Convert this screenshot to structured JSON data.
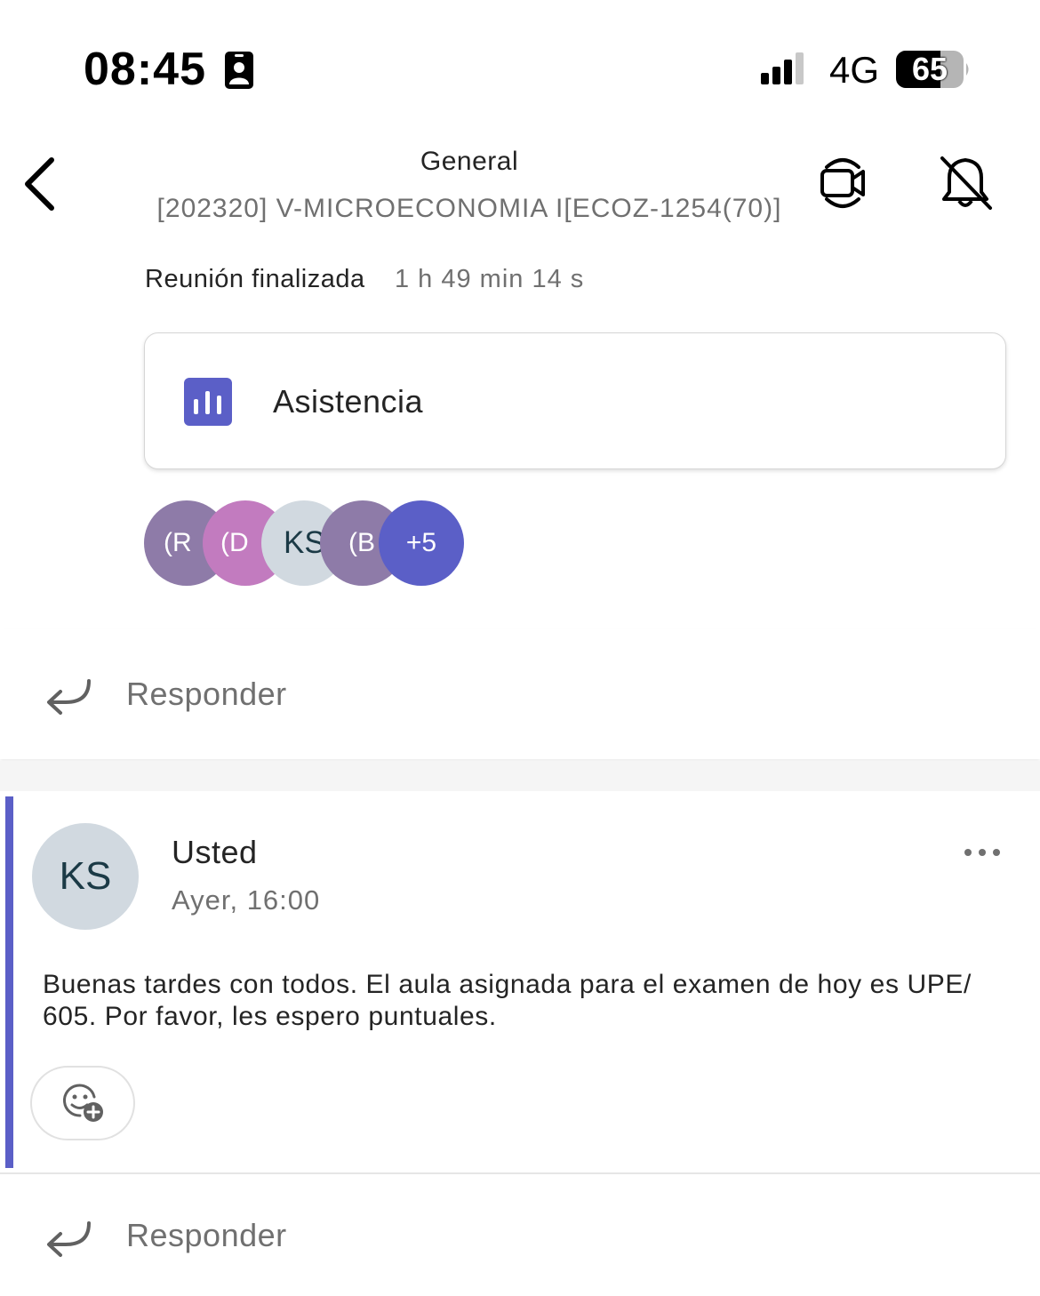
{
  "status_bar": {
    "time": "08:45",
    "network": "4G",
    "battery": "65",
    "icons": [
      "id-badge-icon",
      "signal-icon",
      "battery-icon"
    ]
  },
  "header": {
    "channel": "General",
    "team": "[202320] V-MICROECONOMIA I[ECOZ-1254(70)]",
    "icons": [
      "back-icon",
      "video-call-icon",
      "bell-off-icon"
    ]
  },
  "meeting": {
    "status": "Reunión finalizada",
    "duration": "1 h 49 min 14 s",
    "attendance_label": "Asistencia",
    "attendance_icon": "chart-icon",
    "participants": [
      {
        "initials": "(R",
        "color": "#8e7ba8",
        "text_color": "#ffffff"
      },
      {
        "initials": "(D",
        "color": "#c27bbf",
        "text_color": "#ffffff"
      },
      {
        "initials": "KS",
        "color": "#d1d9e0",
        "text_color": "#1b3a46"
      },
      {
        "initials": "(B",
        "color": "#8e7ba8",
        "text_color": "#ffffff"
      },
      {
        "initials": "+5",
        "color": "#5b5fc7",
        "text_color": "#ffffff"
      }
    ]
  },
  "reply1": {
    "label": "Responder"
  },
  "message": {
    "avatar_initials": "KS",
    "author": "Usted",
    "time": "Ayer, 16:00",
    "body": "Buenas tardes con todos. El aula asignada para el examen de hoy es UPE/ 605. Por favor, les espero puntuales.",
    "accent_color": "#5b5fc7"
  },
  "reply2": {
    "label": "Responder"
  }
}
